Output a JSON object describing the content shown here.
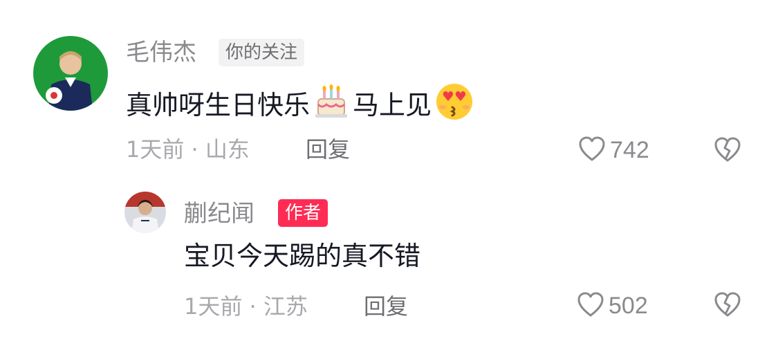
{
  "comments": [
    {
      "username": "毛伟杰",
      "tag": "你的关注",
      "text_before": "真帅呀生日快乐",
      "emoji_1": "birthday-cake",
      "text_middle": "马上见",
      "emoji_2": "heart-eyes-kiss",
      "time": "1天前",
      "separator": "·",
      "location": "山东",
      "reply_label": "回复",
      "likes": "742"
    },
    {
      "username": "蒯纪闻",
      "tag": "作者",
      "text": "宝贝今天踢的真不错",
      "time": "1天前",
      "separator": "·",
      "location": "江苏",
      "reply_label": "回复",
      "likes": "502"
    }
  ],
  "colors": {
    "author_tag_bg": "#fe2c55",
    "follow_tag_bg": "#f2f2f3",
    "username": "#8a8a8e",
    "content": "#161823",
    "meta": "#a8a8ad"
  }
}
